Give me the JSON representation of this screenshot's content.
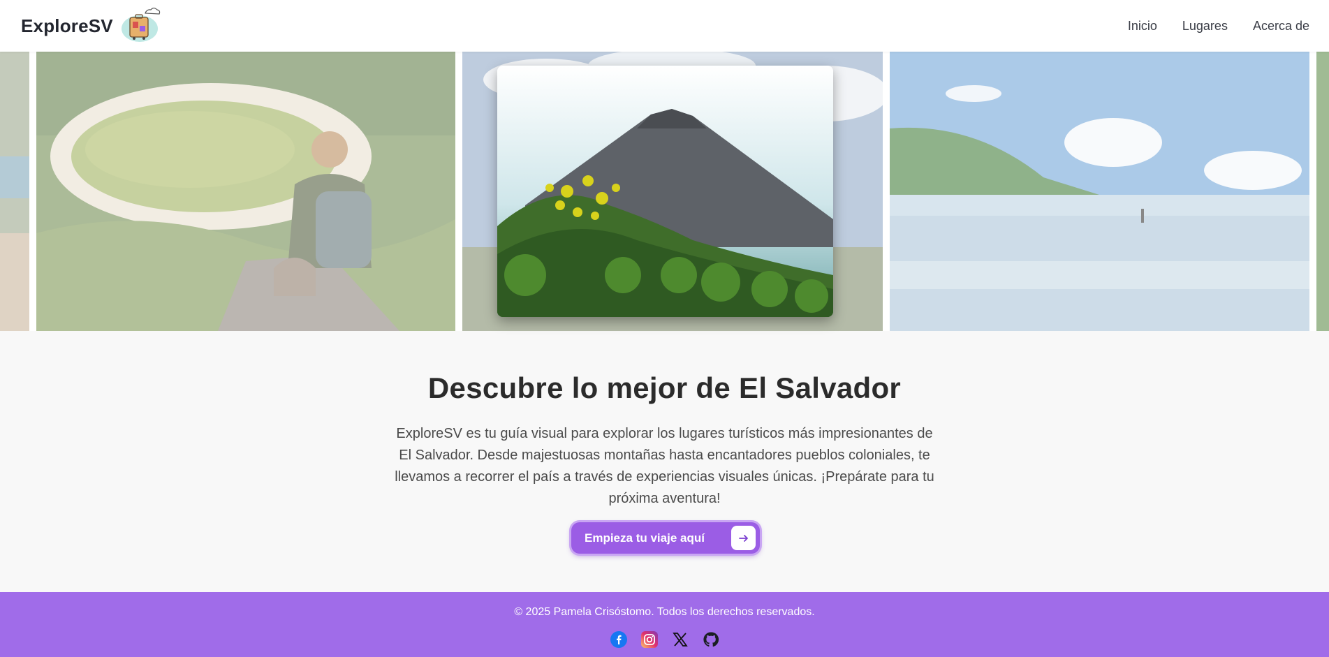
{
  "header": {
    "brand": "ExploreSV",
    "nav": [
      {
        "label": "Inicio"
      },
      {
        "label": "Lugares"
      },
      {
        "label": "Acerca de"
      }
    ]
  },
  "carousel": {
    "featured_index": 2,
    "slide_count": 5
  },
  "hero": {
    "title": "Descubre lo mejor de El Salvador",
    "description": "ExploreSV es tu guía visual para explorar los lugares turísticos más impresionantes de El Salvador. Desde majestuosas montañas hasta encantadores pueblos coloniales, te llevamos a recorrer el país a través de experiencias visuales únicas. ¡Prepárate para tu próxima aventura!",
    "cta_label": "Empieza tu viaje aquí",
    "cta_icon": "arrow-right-icon"
  },
  "footer": {
    "copyright": "© 2025 Pamela Crisóstomo. Todos los derechos reservados.",
    "socials": [
      "facebook-icon",
      "instagram-icon",
      "x-icon",
      "github-icon"
    ]
  },
  "colors": {
    "accent": "#9b5de5",
    "footer_bg": "#a06ce9",
    "page_bg": "#f8f8f8",
    "header_bg": "#ffffff"
  }
}
